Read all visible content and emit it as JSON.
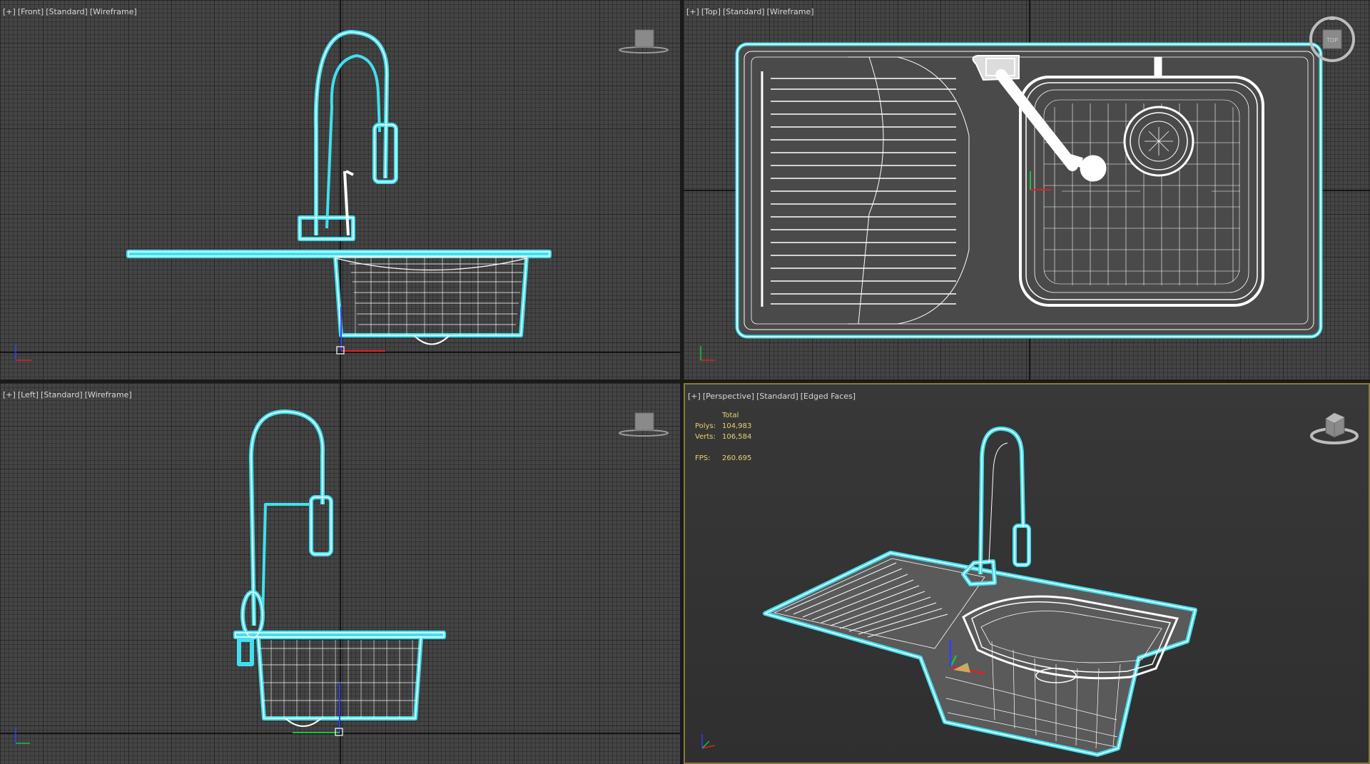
{
  "viewports": {
    "front": {
      "plus": "[+]",
      "view": "[Front]",
      "shading_mode": "[Standard]",
      "display": "[Wireframe]"
    },
    "top": {
      "plus": "[+]",
      "view": "[Top]",
      "shading_mode": "[Standard]",
      "display": "[Wireframe]"
    },
    "left": {
      "plus": "[+]",
      "view": "[Left]",
      "shading_mode": "[Standard]",
      "display": "[Wireframe]"
    },
    "perspective": {
      "plus": "[+]",
      "view": "[Perspective]",
      "shading_mode": "[Standard]",
      "display": "[Edged Faces]"
    }
  },
  "stats": {
    "header": "Total",
    "polys_label": "Polys:",
    "polys_value": "104,983",
    "verts_label": "Verts:",
    "verts_value": "106,584",
    "fps_label": "FPS:",
    "fps_value": "260.695"
  },
  "viewcube_labels": {
    "top": "TOP"
  },
  "colors": {
    "accent_selection": "#40e0f0",
    "wire": "#ffffff",
    "grid_bg": "#444444",
    "active_border": "#8a7a3a",
    "stats_text": "#e8d36a",
    "axis_x": "#e02020",
    "axis_y": "#20c040",
    "axis_z": "#3040ff"
  },
  "icons": [
    "viewcube-icon",
    "steering-wheel-icon",
    "axis-tripod-icon",
    "transform-gizmo-icon"
  ]
}
